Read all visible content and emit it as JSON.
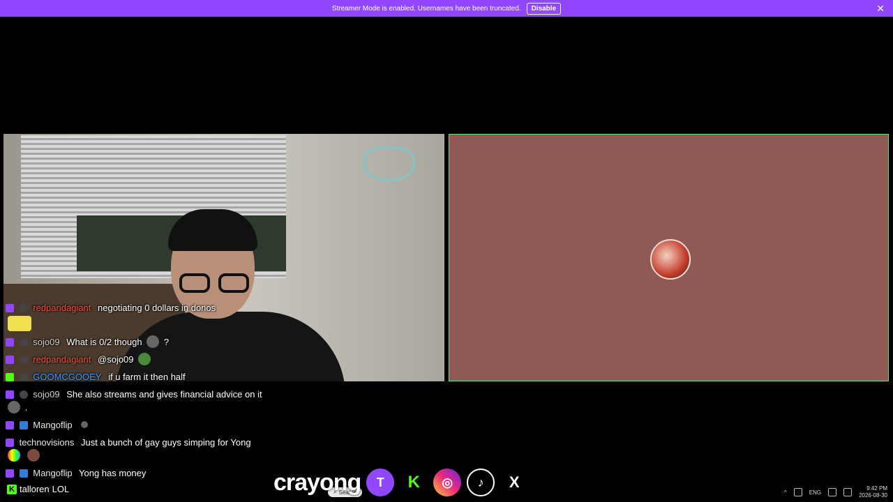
{
  "banner": {
    "message": "Streamer Mode is enabled. Usernames have been truncated.",
    "disable_label": "Disable",
    "close_glyph": "✕",
    "color": "#9147ff"
  },
  "chat": [
    {
      "user": "redpandagiant",
      "color": "#ff4b3e",
      "text": "negotiating 0 dollars in donos"
    },
    {
      "user": "sojo09",
      "color": "#d0d0d0",
      "text": "What is 0/2 though",
      "suffix": "?"
    },
    {
      "user": "redpandagiant",
      "color": "#ff4b3e",
      "text": "@sojo09"
    },
    {
      "user": "GOOMCGOOEY",
      "color": "#3d9bff",
      "text": "if u farm it then half"
    },
    {
      "user": "sojo09",
      "color": "#d0d0d0",
      "text": "She also streams and gives financial advice on it",
      "suffix": "."
    },
    {
      "user": "Mangoflip",
      "color": "#e6e6e6",
      "text": ""
    },
    {
      "user": "technovisions",
      "color": "#e6e6e6",
      "text": "Just a bunch of gay guys simping for Yong"
    },
    {
      "user": "Mangoflip",
      "color": "#e6e6e6",
      "text": "Yong has money"
    }
  ],
  "kick_message": {
    "user": "talloren",
    "text": "LOL"
  },
  "brand": {
    "name": "crayong",
    "socials": [
      {
        "icon": "twitch-icon",
        "glyph": "T"
      },
      {
        "icon": "kick-icon",
        "glyph": "K"
      },
      {
        "icon": "instagram-icon",
        "glyph": "◎"
      },
      {
        "icon": "tiktok-icon",
        "glyph": "♪"
      },
      {
        "icon": "x-icon",
        "glyph": "X"
      }
    ]
  },
  "taskbar": {
    "search_label": "Search",
    "language": "ENG",
    "time": "9:42 PM",
    "date": "2026-08-30"
  }
}
